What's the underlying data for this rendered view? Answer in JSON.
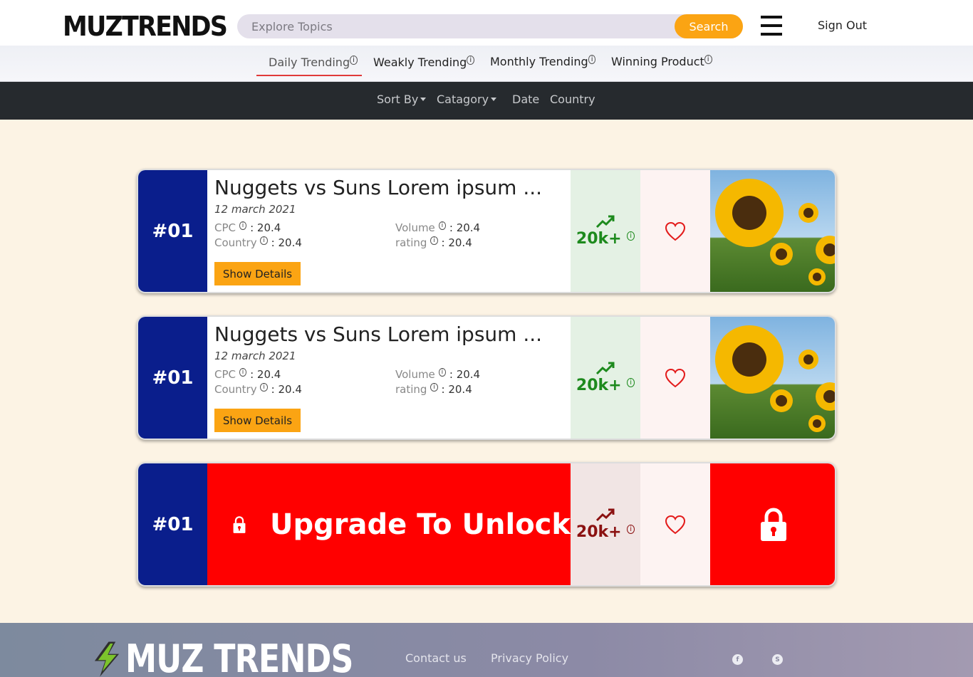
{
  "header": {
    "logo_text": "MUZTRENDS",
    "search_placeholder": "Explore Topics",
    "search_button": "Search",
    "sign_out": "Sign Out"
  },
  "tabs": [
    {
      "label": "Daily Trending",
      "info": "i",
      "active": true
    },
    {
      "label": "Weakly Trending",
      "info": "i"
    },
    {
      "label": "Monthly Trending",
      "info": "i"
    },
    {
      "label": "Winning Product",
      "info": "i"
    }
  ],
  "filters": {
    "sort_by": "Sort By",
    "category": "Catagory",
    "date": "Date",
    "country": "Country"
  },
  "cards": [
    {
      "rank": "#01",
      "title": "Nuggets vs Suns Lorem ipsum ...",
      "date": "12 march 2021",
      "cpc_label": "CPC",
      "cpc_value": ": 20.4",
      "country_label": "Country",
      "country_value": ": 20.4",
      "volume_label": "Volume",
      "volume_value": ": 20.4",
      "rating_label": "rating",
      "rating_value": ": 20.4",
      "details_button": "Show Details",
      "trend_value": "20k+",
      "info": "i"
    },
    {
      "rank": "#01",
      "title": "Nuggets vs Suns Lorem ipsum ...",
      "date": "12 march 2021",
      "cpc_label": "CPC",
      "cpc_value": ": 20.4",
      "country_label": "Country",
      "country_value": ": 20.4",
      "volume_label": "Volume",
      "volume_value": ": 20.4",
      "rating_label": "rating",
      "rating_value": ": 20.4",
      "details_button": "Show Details",
      "trend_value": "20k+",
      "info": "i"
    },
    {
      "rank": "#01",
      "locked_message": "Upgrade To Unlock",
      "trend_value": "20k+",
      "info": "i"
    }
  ],
  "footer": {
    "logo_text": "MUZ TRENDS",
    "contact": "Contact us",
    "privacy": "Privacy Policy",
    "social": [
      "facebook-icon",
      "skype-icon"
    ]
  },
  "colors": {
    "accent": "#fba413",
    "rank_bg": "#0a1e8c",
    "lock_red": "#ff0000",
    "trend_green": "#1d8a1d",
    "page_bg": "#fcf3e4"
  }
}
